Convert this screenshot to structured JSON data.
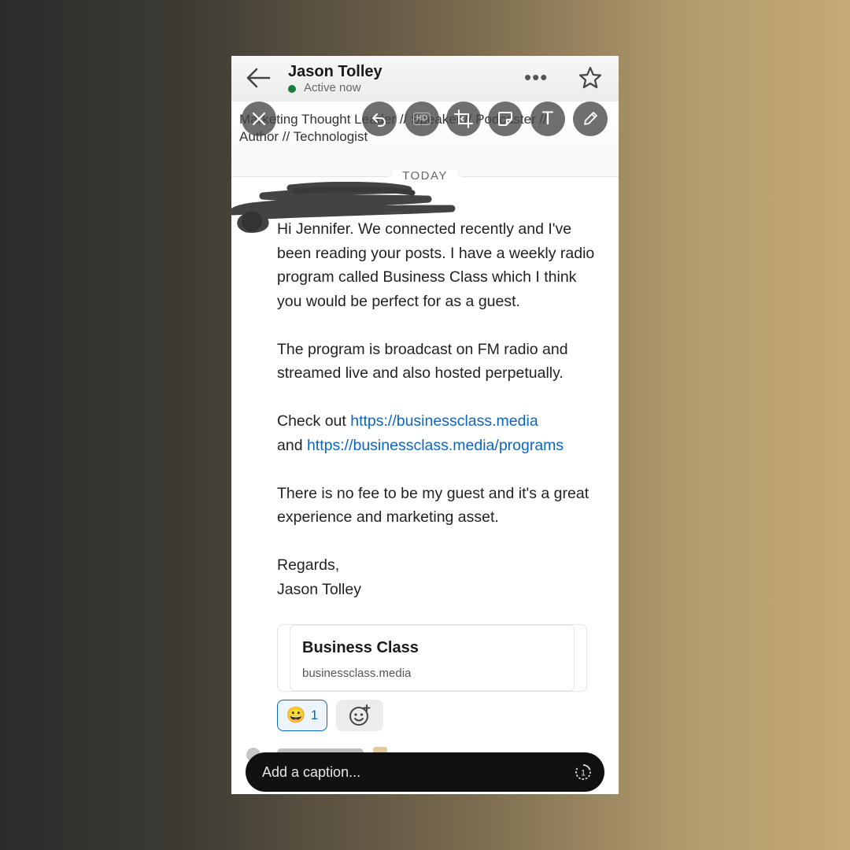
{
  "profile": {
    "name": "Jason Tolley",
    "status": "Active now",
    "headline_line1": "Marketing Thought Leader // Speaker // Podcaster //",
    "headline_line2": "Author // Technologist"
  },
  "icons": {
    "back": "back-arrow-icon",
    "more": "more-dots-icon",
    "star": "star-icon",
    "close": "close-icon",
    "undo": "undo-icon",
    "hd": "hd-icon",
    "crop": "crop-icon",
    "sticker": "sticker-icon",
    "text": "text-icon",
    "draw": "pencil-icon",
    "timer": "view-once-icon"
  },
  "more_label": "•••",
  "text_tool_label": "T",
  "hd_label": "HD",
  "divider": {
    "label": "TODAY"
  },
  "message": {
    "p1": "Hi Jennifer.  We connected recently and I've been reading your posts.  I have a weekly radio program called Business Class which I think you would be perfect for as a guest.",
    "p2": "The program is broadcast on FM radio and streamed live and also hosted perpetually.",
    "p3_prefix": "Check out ",
    "p3_link1": "https://businessclass.media",
    "p3_and": "and ",
    "p3_link2": "https://businessclass.media/programs",
    "p4": "There is no fee to be my guest and it's a great experience and marketing asset.",
    "p5_line1": "Regards,",
    "p5_line2": "Jason Tolley"
  },
  "link_card": {
    "title": "Business Class",
    "url": "businessclass.media"
  },
  "reactions": [
    {
      "emoji": "😀",
      "count": "1"
    }
  ],
  "caption": {
    "placeholder": "Add a caption...",
    "timer_label": "1"
  },
  "colors": {
    "link": "#0a66c2",
    "active_dot": "#1e7a3a",
    "caption_bg": "#111111"
  }
}
